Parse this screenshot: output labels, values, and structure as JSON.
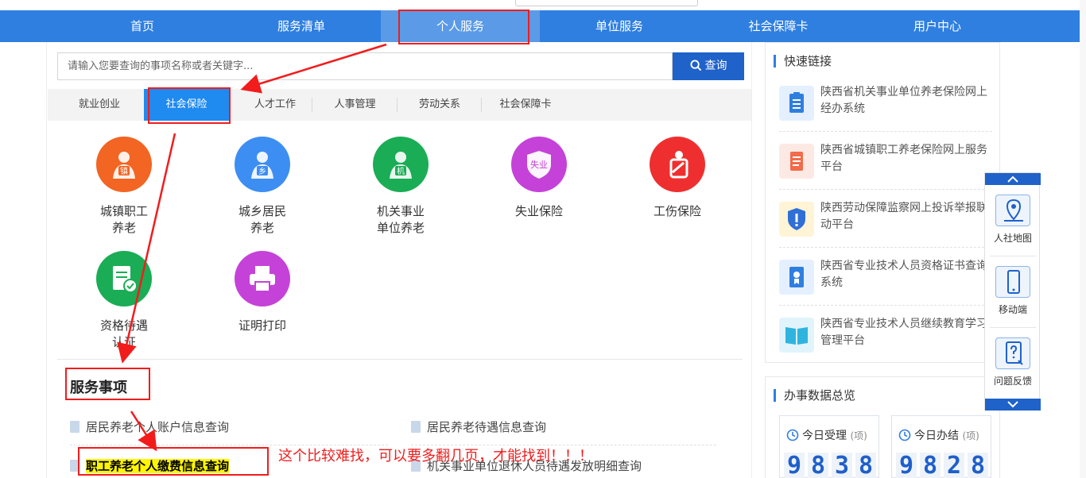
{
  "nav": {
    "items": [
      "首页",
      "服务清单",
      "个人服务",
      "单位服务",
      "社会保障卡",
      "用户中心"
    ],
    "active": "个人服务"
  },
  "search": {
    "placeholder": "请输入您要查询的事项名称或者关键字...",
    "button": "查询"
  },
  "tabs": {
    "items": [
      "就业创业",
      "社会保险",
      "人才工作",
      "人事管理",
      "劳动关系",
      "社会保障卡"
    ],
    "active": "社会保险"
  },
  "services": [
    {
      "label": "城镇职工\n养老",
      "badge": "镇",
      "color": "#f26522"
    },
    {
      "label": "城乡居民\n养老",
      "badge": "乡",
      "color": "#3d8ef2"
    },
    {
      "label": "机关事业\n单位养老",
      "badge": "机",
      "color": "#1aad55"
    },
    {
      "label": "失业保险",
      "badge": "失业",
      "color": "#c542d8"
    },
    {
      "label": "工伤保险",
      "badge": "",
      "color": "#ef2f2f"
    },
    {
      "label": "资格待遇\n认证",
      "badge": "",
      "color": "#1aad55"
    },
    {
      "label": "证明打印",
      "badge": "",
      "color": "#c542d8"
    }
  ],
  "section_title": "服务事项",
  "service_items": [
    "居民养老个人账户信息查询",
    "居民养老待遇信息查询",
    "职工养老个人缴费信息查询",
    "机关事业单位退休人员待遇发放明细查询"
  ],
  "annotation": "这个比较难找，可以要多翻几页，才能找到！！！",
  "quick_links": {
    "title": "快速链接",
    "items": [
      {
        "text": "陕西省机关事业单位养老保险网上经办系统",
        "icon": "clipboard-icon",
        "color": "#2f7fe0"
      },
      {
        "text": "陕西省城镇职工养老保险网上服务平台",
        "icon": "document-icon",
        "color": "#f26b4a"
      },
      {
        "text": "陕西劳动保障监察网上投诉举报联动平台",
        "icon": "shield-icon",
        "color": "#f5b320"
      },
      {
        "text": "陕西省专业技术人员资格证书查询系统",
        "icon": "certificate-icon",
        "color": "#2f7fe0"
      },
      {
        "text": "陕西省专业技术人员继续教育学习管理平台",
        "icon": "book-icon",
        "color": "#2fb4e0"
      }
    ]
  },
  "stats": {
    "title": "办事数据总览",
    "today_accepted_label": "今日受理",
    "today_done_label": "今日办结",
    "unit": "(项)",
    "today_accepted_digits": [
      "9",
      "8",
      "3",
      "8"
    ],
    "today_done_digits": [
      "9",
      "8",
      "2",
      "8"
    ]
  },
  "float_bar": {
    "items": [
      "人社地图",
      "移动端",
      "问题反馈"
    ]
  }
}
